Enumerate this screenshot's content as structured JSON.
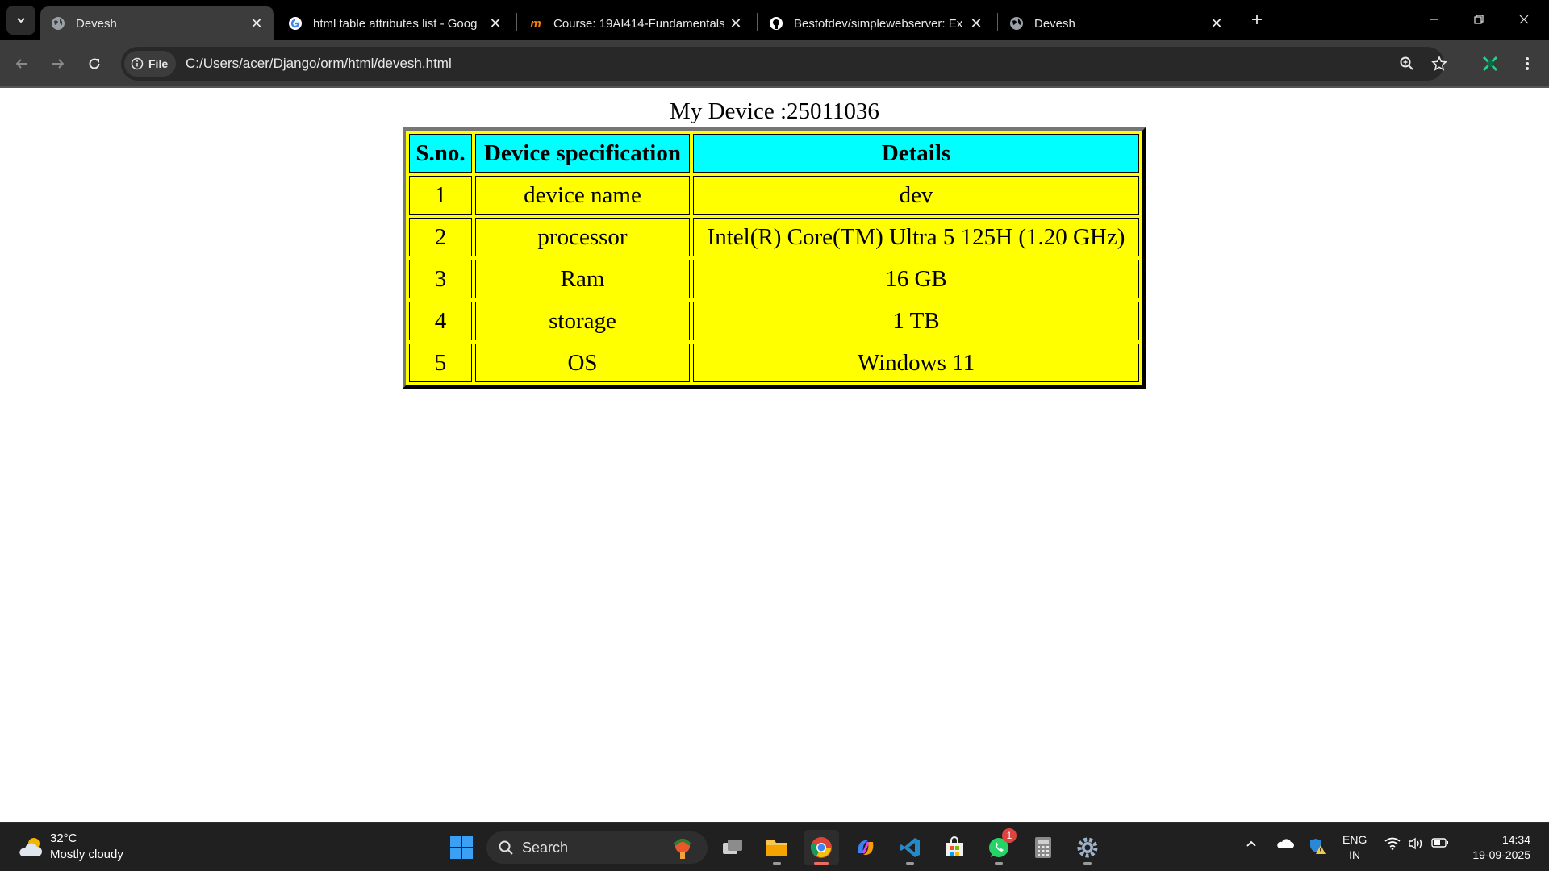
{
  "browser": {
    "tabs": [
      {
        "title": "Devesh",
        "icon": "globe-icon",
        "active": true
      },
      {
        "title": "html table attributes list - Goog",
        "icon": "google-icon",
        "active": false
      },
      {
        "title": "Course: 19AI414-Fundamentals",
        "icon": "moodle-icon",
        "active": false
      },
      {
        "title": "Bestofdev/simplewebserver: Ex",
        "icon": "github-icon",
        "active": false
      },
      {
        "title": "Devesh",
        "icon": "globe-icon",
        "active": false
      }
    ],
    "new_tab_label": "+",
    "site_info_label": "File",
    "url": "C:/Users/acer/Django/orm/html/devesh.html"
  },
  "page": {
    "caption": "My Device :25011036",
    "table": {
      "headers": [
        "S.no.",
        "Device specification",
        "Details"
      ],
      "rows": [
        [
          "1",
          "device name",
          "dev"
        ],
        [
          "2",
          "processor",
          "Intel(R) Core(TM) Ultra 5 125H (1.20 GHz)"
        ],
        [
          "3",
          "Ram",
          "16 GB"
        ],
        [
          "4",
          "storage",
          "1 TB"
        ],
        [
          "5",
          "OS",
          "Windows 11"
        ]
      ],
      "header_color": "#00ffff",
      "cell_color": "#ffff00"
    }
  },
  "taskbar": {
    "weather": {
      "temp": "32°C",
      "condition": "Mostly cloudy"
    },
    "search_label": "Search",
    "whatsapp_badge": "1",
    "language": {
      "line1": "ENG",
      "line2": "IN"
    },
    "clock": {
      "time": "14:34",
      "date": "19-09-2025"
    },
    "apps": [
      "start-icon",
      "search",
      "task-view-icon",
      "file-explorer-icon",
      "chrome-icon",
      "copilot-icon",
      "vscode-icon",
      "store-icon",
      "whatsapp-icon",
      "calculator-icon",
      "settings-icon"
    ]
  }
}
